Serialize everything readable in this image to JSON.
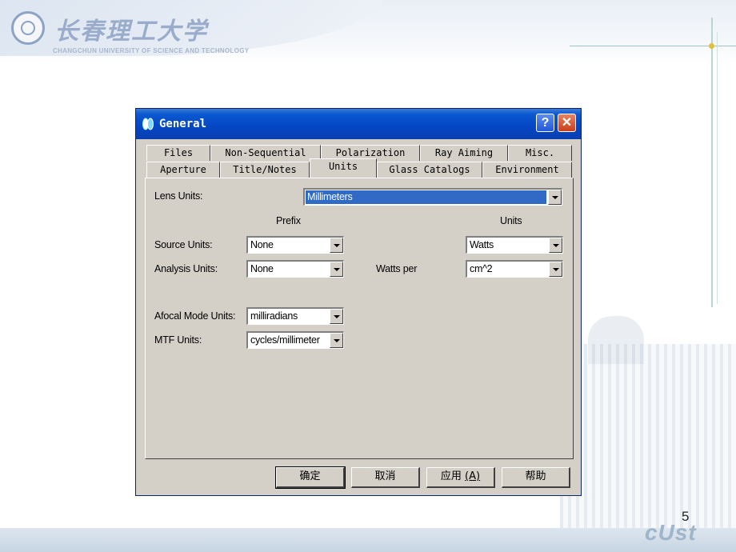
{
  "slide": {
    "university_cn": "长春理工大学",
    "university_en": "CHANGCHUN UNIVERSITY OF SCIENCE AND TECHNOLOGY",
    "page_number": "5",
    "footer_logo": "cUst"
  },
  "dialog": {
    "title": "General",
    "help_button": "?",
    "close_button": "✕",
    "tabs_row1": [
      "Files",
      "Non-Sequential",
      "Polarization",
      "Ray Aiming",
      "Misc."
    ],
    "tabs_row2": [
      "Aperture",
      "Title/Notes",
      "Units",
      "Glass Catalogs",
      "Environment"
    ],
    "active_tab": "Units",
    "units": {
      "lens_units_label": "Lens Units:",
      "lens_units_value": "Millimeters",
      "prefix_header": "Prefix",
      "units_header": "Units",
      "source_units_label": "Source Units:",
      "source_prefix_value": "None",
      "source_units_value": "Watts",
      "analysis_units_label": "Analysis Units:",
      "analysis_prefix_value": "None",
      "watts_per_label": "Watts per",
      "analysis_units_value": "cm^2",
      "afocal_label": "Afocal Mode Units:",
      "afocal_value": "milliradians",
      "mtf_label": "MTF Units:",
      "mtf_value": "cycles/millimeter"
    },
    "buttons": {
      "ok": "确定",
      "cancel": "取消",
      "apply": "应用",
      "apply_key": "(A)",
      "help": "帮助"
    }
  }
}
